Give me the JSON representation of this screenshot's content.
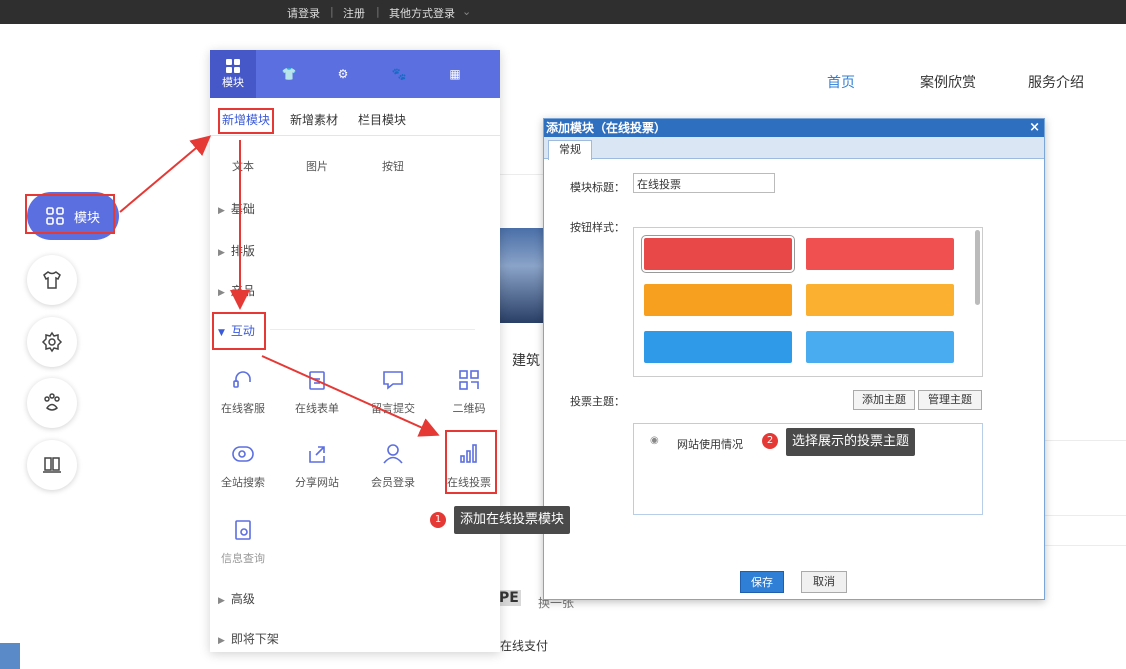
{
  "topbar": {
    "login": "请登录",
    "register": "注册",
    "other_login": "其他方式登录"
  },
  "nav": {
    "home": "首页",
    "cases": "案例欣赏",
    "service": "服务介绍"
  },
  "background": {
    "building_text": "建筑",
    "captcha_text": "PE",
    "refresh_text": "换一张",
    "required_mark": "*",
    "pay_text": "在线支付"
  },
  "float_button": {
    "label": "模块"
  },
  "panel": {
    "top_tab_label": "模块",
    "subtabs": {
      "new_module": "新增模块",
      "new_material": "新增素材",
      "column_module": "栏目模块"
    },
    "basic_items": [
      "文本",
      "图片",
      "按钮"
    ],
    "groups": {
      "base": "基础",
      "layout": "排版",
      "product": "产品",
      "interactive": "互动",
      "advanced": "高级",
      "retiring": "即将下架"
    },
    "interactive_items": [
      "在线客服",
      "在线表单",
      "留言提交",
      "二维码",
      "全站搜索",
      "分享网站",
      "会员登录",
      "在线投票",
      "信息查询"
    ]
  },
  "dialog": {
    "title": "添加模块（在线投票）",
    "close": "×",
    "tab": "常规",
    "module_title_label": "模块标题：",
    "module_title_value": "在线投票",
    "button_style_label": "按钮样式：",
    "button_styles": [
      "#e84848",
      "#f05050",
      "#f7a020",
      "#fbb030",
      "#2f9be8",
      "#4aacf0"
    ],
    "vote_topic_label": "投票主题：",
    "add_topic": "添加主题",
    "manage_topic": "管理主题",
    "vote_option": "网站使用情况",
    "save": "保存",
    "cancel": "取消"
  },
  "tips": {
    "tip1_num": "1",
    "tip1_text": "添加在线投票模块",
    "tip2_num": "2",
    "tip2_text": "选择展示的投票主题"
  },
  "colors": {
    "accent": "#5b6fe0",
    "highlight": "#e53935"
  }
}
